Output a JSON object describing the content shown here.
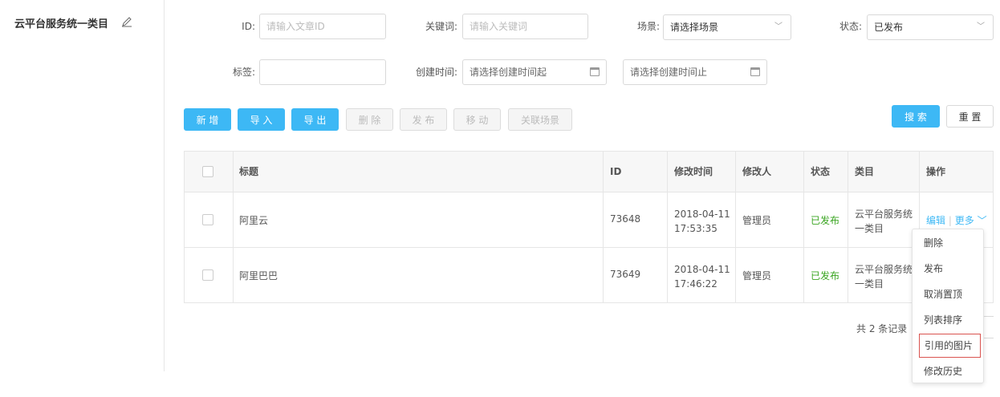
{
  "sidebar": {
    "category_title": "云平台服务统一类目"
  },
  "filters": {
    "id": {
      "label": "ID",
      "placeholder": "请输入文章ID"
    },
    "keyword": {
      "label": "关键词",
      "placeholder": "请输入关键词"
    },
    "scene": {
      "label": "场景",
      "value": "请选择场景"
    },
    "status": {
      "label": "状态",
      "value": "已发布"
    },
    "tag": {
      "label": "标签",
      "value": ""
    },
    "created_time": {
      "label": "创建时间",
      "start_placeholder": "请选择创建时间起",
      "end_placeholder": "请选择创建时间止"
    },
    "colon": ":"
  },
  "toolbar": {
    "add": "新 增",
    "import": "导 入",
    "export": "导 出",
    "delete": "删 除",
    "publish": "发 布",
    "move": "移 动",
    "link_scene": "关联场景",
    "search": "搜 索",
    "reset": "重 置"
  },
  "table": {
    "headers": {
      "title": "标题",
      "id": "ID",
      "modified_time": "修改时间",
      "modifier": "修改人",
      "status": "状态",
      "category": "类目",
      "actions": "操作"
    },
    "rows": [
      {
        "title": "阿里云",
        "id": "73648",
        "date": "2018-04-11",
        "time": "17:53:35",
        "modifier": "管理员",
        "status": "已发布",
        "category_line1": "云平台服务统",
        "category_line2": "一类目"
      },
      {
        "title": "阿里巴巴",
        "id": "73649",
        "date": "2018-04-11",
        "time": "17:46:22",
        "modifier": "管理员",
        "status": "已发布",
        "category_line1": "云平台服务统",
        "category_line2": "一类目"
      }
    ],
    "row_actions": {
      "edit": "编辑",
      "sep": "|",
      "more": "更多"
    }
  },
  "pagination": {
    "total_text": "共 2 条记录"
  },
  "more_menu": {
    "items": [
      "删除",
      "发布",
      "取消置顶",
      "列表排序",
      "引用的图片",
      "修改历史"
    ]
  },
  "colors": {
    "primary": "#3db8f5",
    "success": "#3aa521",
    "highlight_border": "#d9534f"
  }
}
